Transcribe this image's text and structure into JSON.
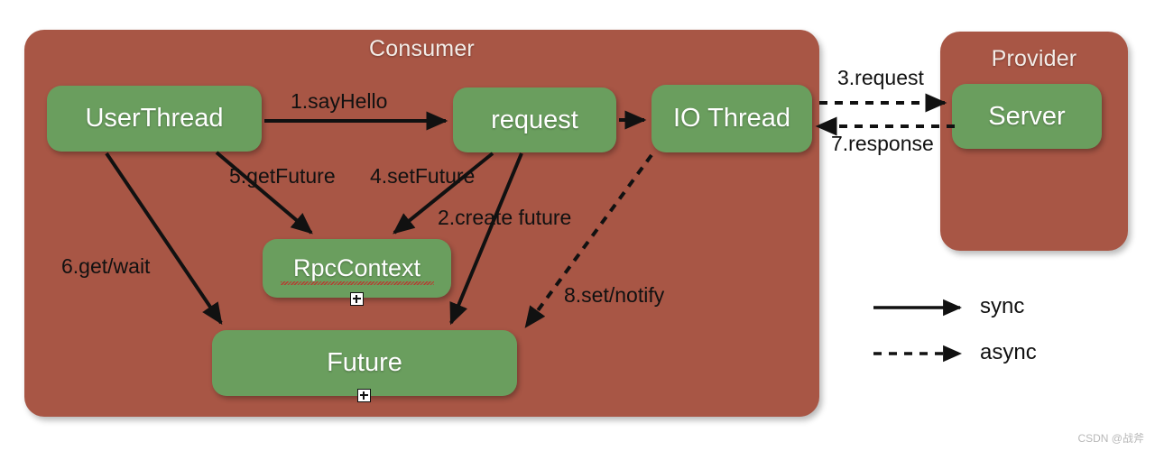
{
  "watermark": "CSDN @战斧",
  "colors": {
    "panel_red": "#a85645",
    "node_green": "#6a9e5e",
    "arrow_black": "#111111",
    "panel_title_text": "#f3ece7",
    "node_text": "#ffffff",
    "squiggle_red": "#c62828",
    "background": "#ffffff"
  },
  "panels": [
    {
      "id": "consumer",
      "title": "Consumer"
    },
    {
      "id": "provider",
      "title": "Provider"
    }
  ],
  "nodes": [
    {
      "id": "userthread",
      "label": "UserThread",
      "panel": "consumer",
      "expandable": false
    },
    {
      "id": "request",
      "label": "request",
      "panel": "consumer",
      "expandable": false
    },
    {
      "id": "iothread",
      "label": "IO Thread",
      "panel": "consumer",
      "expandable": false
    },
    {
      "id": "rpccontext",
      "label": "RpcContext",
      "panel": "consumer",
      "expandable": true,
      "spellcheck_underline": true
    },
    {
      "id": "future",
      "label": "Future",
      "panel": "consumer",
      "expandable": true
    },
    {
      "id": "server",
      "label": "Server",
      "panel": "provider",
      "expandable": false
    }
  ],
  "edges": [
    {
      "id": "sayhello",
      "label": "1.sayHello",
      "from": "userthread",
      "to": "request",
      "kind": "sync"
    },
    {
      "id": "createfuture",
      "label": "2.create future",
      "from": "request",
      "to": "future",
      "kind": "sync"
    },
    {
      "id": "request",
      "label": "3.request",
      "from": "iothread",
      "to": "server",
      "kind": "async"
    },
    {
      "id": "setfuture",
      "label": "4.setFuture",
      "from": "request",
      "to": "rpccontext",
      "kind": "sync"
    },
    {
      "id": "getfuture",
      "label": "5.getFuture",
      "from": "userthread",
      "to": "rpccontext",
      "kind": "sync"
    },
    {
      "id": "getwait",
      "label": "6.get/wait",
      "from": "userthread",
      "to": "future",
      "kind": "sync"
    },
    {
      "id": "response",
      "label": "7.response",
      "from": "server",
      "to": "iothread",
      "kind": "async"
    },
    {
      "id": "setnotify",
      "label": "8.set/notify",
      "from": "iothread",
      "to": "future",
      "kind": "async"
    },
    {
      "id": "req-to-io",
      "label": "",
      "from": "request",
      "to": "iothread",
      "kind": "sync"
    }
  ],
  "legend": {
    "items": [
      {
        "id": "sync",
        "label": "sync",
        "style": "solid-arrow"
      },
      {
        "id": "async",
        "label": "async",
        "style": "dashed-arrow"
      }
    ]
  }
}
